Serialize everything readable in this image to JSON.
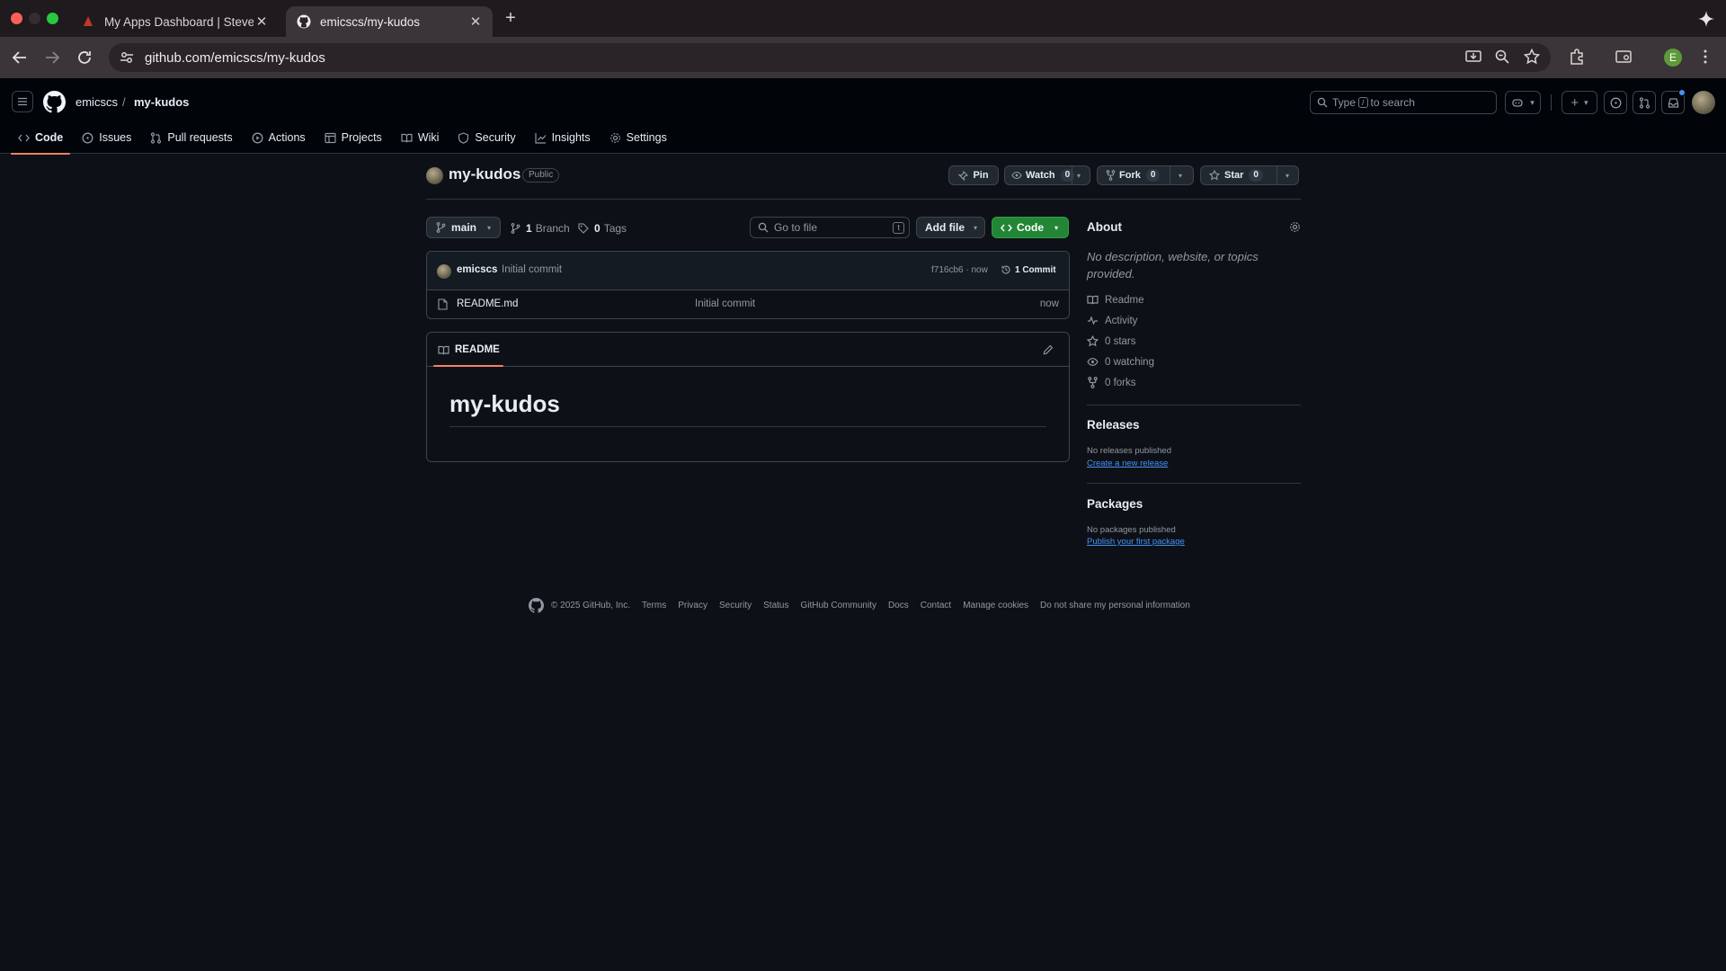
{
  "browser": {
    "tabs": [
      {
        "title": "My Apps Dashboard | Steven…",
        "active": false
      },
      {
        "title": "emicscs/my-kudos",
        "active": true
      }
    ],
    "url": "github.com/emicscs/my-kudos",
    "profile_initial": "E"
  },
  "header": {
    "owner": "emicscs",
    "separator": "/",
    "repo": "my-kudos",
    "search_prefix": "Type",
    "search_key": "/",
    "search_suffix": "to search"
  },
  "repo_tabs": [
    {
      "label": "Code",
      "icon": "code-icon",
      "active": true
    },
    {
      "label": "Issues",
      "icon": "issue-icon"
    },
    {
      "label": "Pull requests",
      "icon": "pull-request-icon"
    },
    {
      "label": "Actions",
      "icon": "play-icon"
    },
    {
      "label": "Projects",
      "icon": "table-icon"
    },
    {
      "label": "Wiki",
      "icon": "book-icon"
    },
    {
      "label": "Security",
      "icon": "shield-icon"
    },
    {
      "label": "Insights",
      "icon": "graph-icon"
    },
    {
      "label": "Settings",
      "icon": "gear-icon"
    }
  ],
  "repo": {
    "name": "my-kudos",
    "visibility": "Public",
    "pin_label": "Pin",
    "watch_label": "Watch",
    "watch_count": "0",
    "fork_label": "Fork",
    "fork_count": "0",
    "star_label": "Star",
    "star_count": "0"
  },
  "filebar": {
    "branch": "main",
    "branches_count": "1",
    "branches_label": "Branch",
    "tags_count": "0",
    "tags_label": "Tags",
    "goto_placeholder": "Go to file",
    "goto_key": "t",
    "add_file_label": "Add file",
    "code_label": "Code"
  },
  "commit": {
    "author": "emicscs",
    "message": "Initial commit",
    "sha_time": "f716cb6 · now",
    "count_label": "1 Commit"
  },
  "files": [
    {
      "name": "README.md",
      "message": "Initial commit",
      "time": "now"
    }
  ],
  "readme": {
    "tab_label": "README",
    "heading": "my-kudos"
  },
  "about": {
    "title": "About",
    "description": "No description, website, or topics provided.",
    "items": [
      {
        "label": "Readme",
        "icon": "book-icon"
      },
      {
        "label": "Activity",
        "icon": "pulse-icon"
      },
      {
        "label": "0 stars",
        "icon": "star-icon"
      },
      {
        "label": "0 watching",
        "icon": "eye-icon"
      },
      {
        "label": "0 forks",
        "icon": "fork-icon"
      }
    ]
  },
  "releases": {
    "title": "Releases",
    "empty": "No releases published",
    "link": "Create a new release"
  },
  "packages": {
    "title": "Packages",
    "empty": "No packages published",
    "link": "Publish your first package"
  },
  "footer": {
    "copyright": "© 2025 GitHub, Inc.",
    "links": [
      "Terms",
      "Privacy",
      "Security",
      "Status",
      "GitHub Community",
      "Docs",
      "Contact",
      "Manage cookies",
      "Do not share my personal information"
    ]
  },
  "colors": {
    "accent_green": "#238636",
    "underline_orange": "#f78166",
    "link_blue": "#4493f8"
  }
}
